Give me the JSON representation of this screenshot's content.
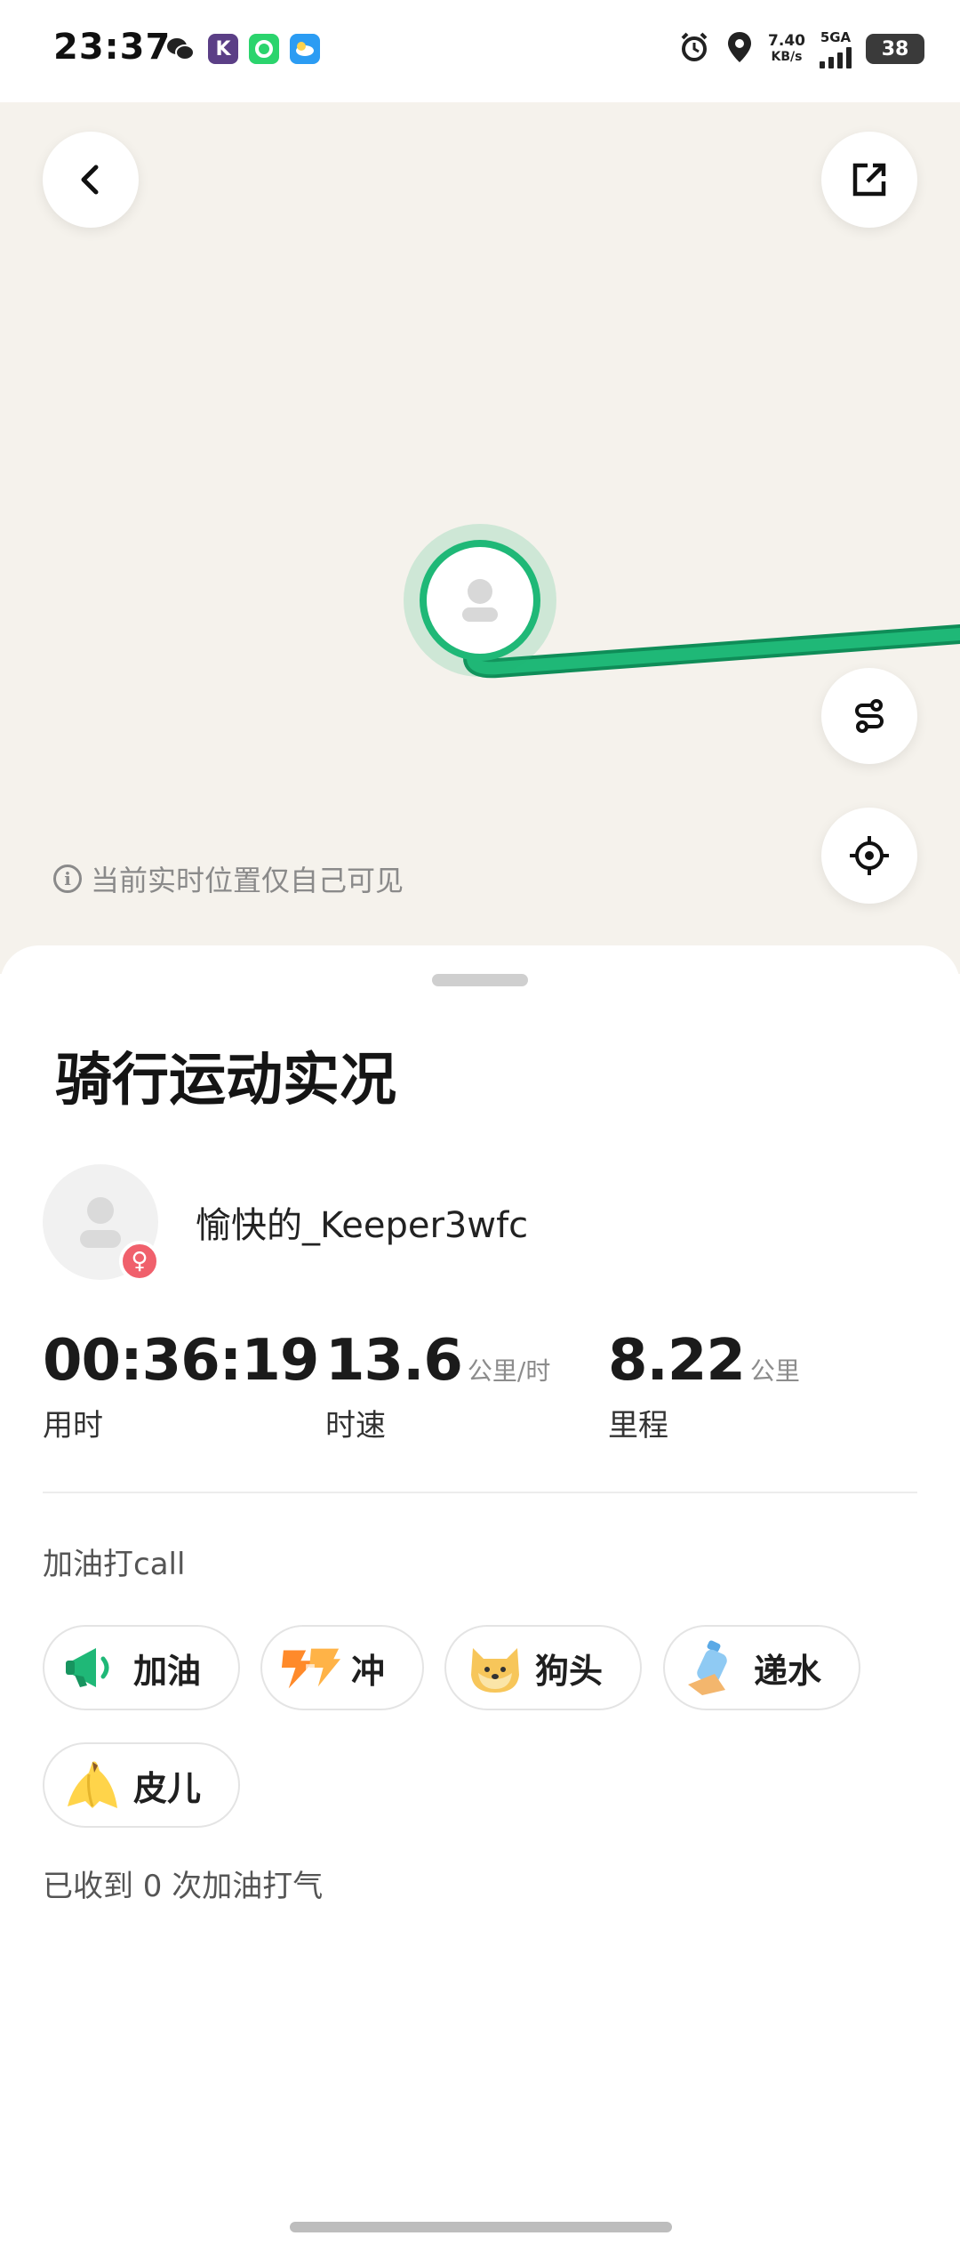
{
  "status_bar": {
    "time": "23:37",
    "net_speed_value": "7.40",
    "net_speed_unit": "KB/s",
    "network_type": "5GA",
    "battery": "38",
    "icons": [
      "wechat-icon",
      "k-app-icon",
      "green-app-icon",
      "weather-app-icon",
      "alarm-icon",
      "location-icon"
    ]
  },
  "map": {
    "notice": "当前实时位置仅自己可见",
    "route_color": "#1fb877"
  },
  "sheet": {
    "title": "骑行运动实况",
    "user": {
      "name": "愉快的_Keeper3wfc",
      "gender_symbol": "♀"
    },
    "stats": [
      {
        "value": "00:36:19",
        "unit": "",
        "label": "用时"
      },
      {
        "value": "13.6",
        "unit": "公里/时",
        "label": "时速"
      },
      {
        "value": "8.22",
        "unit": "公里",
        "label": "里程"
      }
    ],
    "cheer_heading": "加油打call",
    "cheers": [
      {
        "label": "加油",
        "icon": "megaphone-icon"
      },
      {
        "label": "冲",
        "icon": "rush-icon"
      },
      {
        "label": "狗头",
        "icon": "doge-icon"
      },
      {
        "label": "递水",
        "icon": "water-bottle-icon"
      },
      {
        "label": "皮儿",
        "icon": "banana-peel-icon"
      }
    ],
    "received_text": "已收到 0 次加油打气"
  },
  "colors": {
    "accent_green": "#1fb877",
    "badge_pink": "#f0606c"
  }
}
